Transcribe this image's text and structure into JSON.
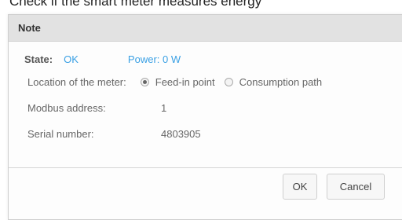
{
  "background": {
    "partial_text": "Check if the smart meter measures energy"
  },
  "dialog": {
    "title": "Note",
    "state_label": "State:",
    "state_value": "OK",
    "power_text": "Power: 0 W",
    "location_label": "Location of the meter:",
    "location_options": [
      {
        "label": "Feed-in point",
        "selected": true
      },
      {
        "label": "Consumption path",
        "selected": false
      }
    ],
    "modbus_label": "Modbus address:",
    "modbus_value": "1",
    "serial_label": "Serial number:",
    "serial_value": "4803905",
    "ok_label": "OK",
    "cancel_label": "Cancel"
  },
  "colors": {
    "accent": "#3aa0e4",
    "header_bg": "#e2e2e2"
  }
}
